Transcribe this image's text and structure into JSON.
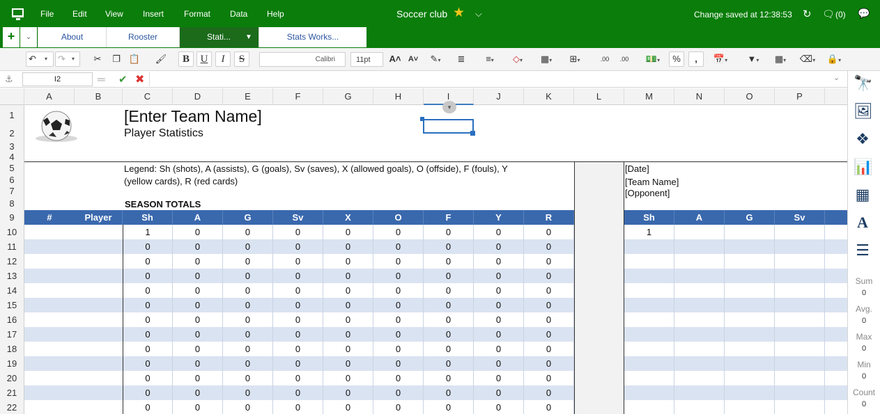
{
  "menubar": {
    "items": [
      "File",
      "Edit",
      "View",
      "Insert",
      "Format",
      "Data",
      "Help"
    ],
    "doc_title": "Soccer club",
    "saved_status": "Change saved at 12:38:53",
    "comment_count": "(0)"
  },
  "tabs": {
    "add_label": "+",
    "items": [
      {
        "label": "About",
        "active": false
      },
      {
        "label": "Rooster",
        "active": false
      },
      {
        "label": "Stati...",
        "active": true
      },
      {
        "label": "Stats Works...",
        "active": false
      }
    ]
  },
  "toolbar": {
    "font_name": "Calibri",
    "font_size": "11pt",
    "bold_label": "B",
    "underline_label": "U",
    "italic_label": "I",
    "strike_label": "S",
    "percent_label": "%",
    "comma_label": ","
  },
  "formula": {
    "cell_ref": "I2",
    "value": ""
  },
  "grid": {
    "columns": [
      "A",
      "B",
      "C",
      "D",
      "E",
      "F",
      "G",
      "H",
      "I",
      "J",
      "K",
      "L",
      "M",
      "N",
      "O",
      "P"
    ],
    "selected_column": "I",
    "rows": [
      "1",
      "2",
      "3",
      "4",
      "5",
      "6",
      "7",
      "8",
      "9",
      "10",
      "11",
      "12",
      "13",
      "14",
      "15",
      "16",
      "17",
      "18",
      "19",
      "20",
      "21",
      "22"
    ],
    "team_name": "[Enter Team Name]",
    "subtitle": "Player Statistics",
    "legend": "Legend: Sh (shots), A (assists), G (goals), Sv (saves), X (allowed goals), O (offside), F (fouls), Y",
    "legend_cont": "(yellow cards), R (red cards)",
    "season_totals": "SEASON TOTALS",
    "date_ph": "[Date]",
    "team_ph": "[Team Name]",
    "opponent_ph": "[Opponent]",
    "headers_left": [
      "#",
      "Player",
      "Sh",
      "A",
      "G",
      "Sv",
      "X",
      "O",
      "F",
      "Y",
      "R"
    ],
    "headers_right": [
      "Sh",
      "A",
      "G",
      "Sv"
    ],
    "first_row": [
      "1",
      "0",
      "0",
      "0",
      "0",
      "0",
      "0",
      "0",
      "0"
    ],
    "data_row": [
      "0",
      "0",
      "0",
      "0",
      "0",
      "0",
      "0",
      "0",
      "0"
    ],
    "right_first": "1"
  },
  "side": {
    "sum_label": "Sum",
    "sum_value": "0",
    "avg_label": "Avg.",
    "avg_value": "0",
    "max_label": "Max",
    "max_value": "0",
    "min_label": "Min",
    "min_value": "0",
    "count_label": "Count",
    "count_value": "0"
  },
  "colors": {
    "brand_green": "#0a7d0a",
    "active_tab": "#1b6b1b",
    "header_blue": "#3a68ad",
    "band_blue": "#dae3f1"
  }
}
